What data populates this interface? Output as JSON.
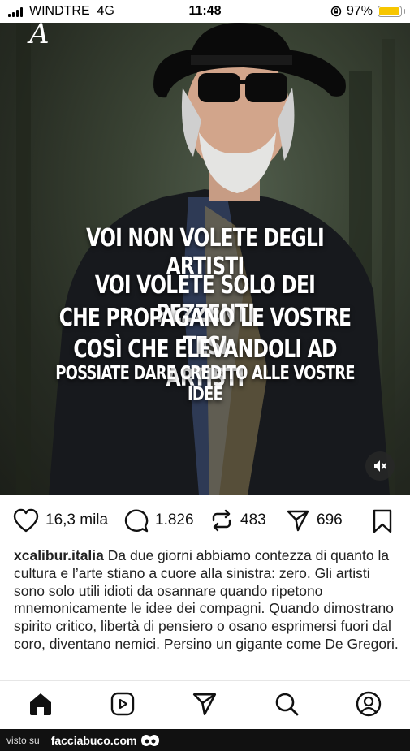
{
  "status_bar": {
    "carrier": "WINDTRE",
    "network": "4G",
    "time": "11:48",
    "battery": "97%",
    "battery_level": 0.97,
    "battery_color": "#f7c600"
  },
  "post": {
    "brand_mark": "A",
    "quote_lines": [
      "VOI NON VOLETE DEGLI ARTISTI",
      "VOI VOLETE SOLO DEI PEZZENTI",
      "CHE PROPAGANO LE VOSTRE TESI",
      "COSÌ CHE ELEVANDOLI AD ARTISTI",
      "POSSIATE DARE CREDITO ALLE VOSTRE IDEE"
    ],
    "mute_icon": "speaker-muted-icon"
  },
  "actions": {
    "likes": "16,3 mila",
    "comments": "1.826",
    "reposts": "483",
    "shares": "696"
  },
  "caption": {
    "username": "xcalibur.italia",
    "text": "Da due giorni abbiamo contezza di quanto la cultura e l’arte stiano a cuore alla sinistra: zero. Gli artisti sono solo utili idioti da osannare quando ripetono mnemonicamente le idee dei compagni. Quando dimostrano spirito critico, libertà di pensiero o osano esprimersi fuori dal coro, diventano nemici. Persino un gigante come De Gregori."
  },
  "nav": [
    "home-icon",
    "reels-icon",
    "send-icon",
    "search-icon",
    "profile-icon"
  ],
  "watermark": {
    "prefix": "visto su",
    "site": "facciabuco.com"
  }
}
